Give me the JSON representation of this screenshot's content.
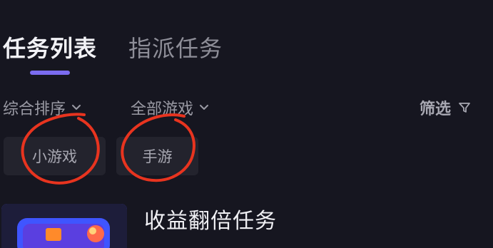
{
  "tabs": [
    {
      "label": "任务列表",
      "active": true
    },
    {
      "label": "指派任务",
      "active": false
    }
  ],
  "filters": {
    "sort_label": "综合排序",
    "game_label": "全部游戏",
    "screen_label": "筛选",
    "sort_icon": "chevron-down-icon",
    "game_icon": "chevron-down-icon",
    "screen_icon": "filter-funnel-icon"
  },
  "chips": [
    {
      "label": "小游戏"
    },
    {
      "label": "手游"
    }
  ],
  "task": {
    "title": "收益翻倍任务",
    "thumbnail_icon": "game-controller-thumbnail"
  },
  "colors": {
    "background": "#161620",
    "accent": "#7b6cf0",
    "chip_bg": "#23232d",
    "annotation": "#e8341f"
  }
}
